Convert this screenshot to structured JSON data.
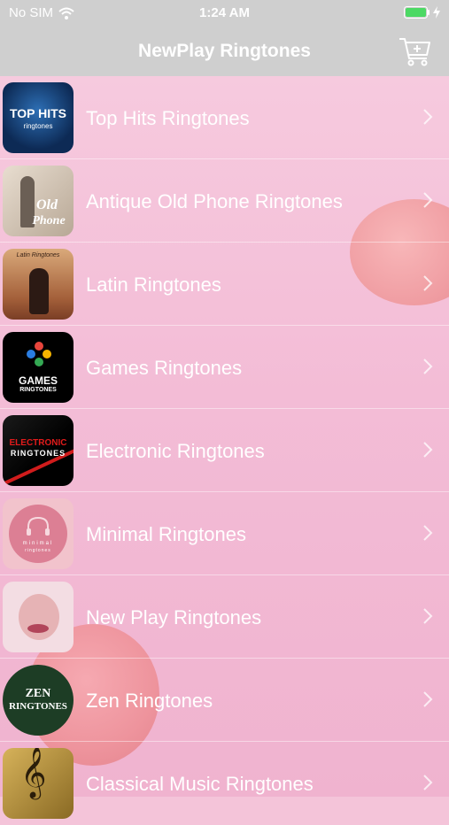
{
  "status_bar": {
    "carrier": "No SIM",
    "time": "1:24 AM"
  },
  "nav": {
    "title": "NewPlay Ringtones",
    "cart_icon": "cart-plus-icon"
  },
  "items": [
    {
      "label": "Top Hits Ringtones",
      "thumb_text": "TOP HITS",
      "thumb_sub": "ringtones"
    },
    {
      "label": "Antique Old Phone Ringtones",
      "thumb_text": "Old",
      "thumb_sub": "Phone"
    },
    {
      "label": "Latin Ringtones",
      "thumb_text": "Latin Ringtones",
      "thumb_sub": ""
    },
    {
      "label": "Games Ringtones",
      "thumb_text": "GAMES",
      "thumb_sub": "RINGTONES"
    },
    {
      "label": "Electronic Ringtones",
      "thumb_text": "ELECTRONIC",
      "thumb_sub": "RINGTONES"
    },
    {
      "label": "Minimal Ringtones",
      "thumb_text": "minimal",
      "thumb_sub": "ringtones"
    },
    {
      "label": "New Play Ringtones",
      "thumb_text": "",
      "thumb_sub": ""
    },
    {
      "label": "Zen Ringtones",
      "thumb_text": "ZEN",
      "thumb_sub": "RINGTONES"
    },
    {
      "label": "Classical Music Ringtones",
      "thumb_text": "",
      "thumb_sub": ""
    }
  ],
  "colors": {
    "navbar": "#cfcfcf",
    "background": "#f4c4d9",
    "text": "#ffffff",
    "battery": "#4cd964"
  }
}
